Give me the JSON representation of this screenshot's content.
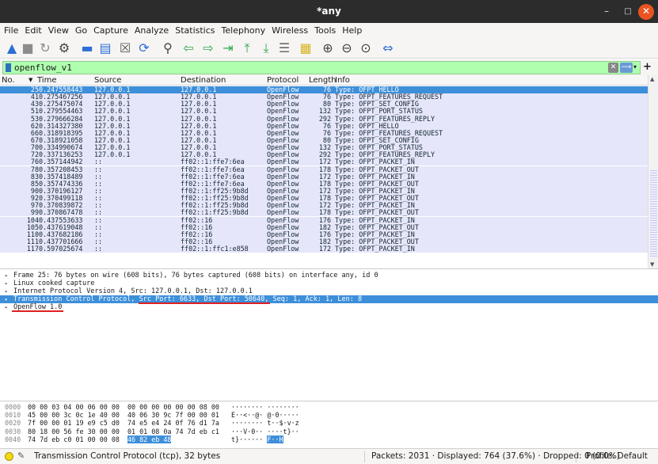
{
  "window": {
    "title": "*any"
  },
  "menu": [
    "File",
    "Edit",
    "View",
    "Go",
    "Capture",
    "Analyze",
    "Statistics",
    "Telephony",
    "Wireless",
    "Tools",
    "Help"
  ],
  "filter": {
    "value": "openflow_v1"
  },
  "columns": {
    "no": "No.",
    "time": "Time",
    "source": "Source",
    "destination": "Destination",
    "protocol": "Protocol",
    "length": "Length",
    "info": "Info"
  },
  "packets": [
    {
      "no": "25",
      "time": "0.247558443",
      "src": "127.0.0.1",
      "dst": "127.0.0.1",
      "proto": "OpenFlow",
      "len": "76",
      "info": "Type: OFPT_HELLO",
      "selected": true
    },
    {
      "no": "41",
      "time": "0.275467256",
      "src": "127.0.0.1",
      "dst": "127.0.0.1",
      "proto": "OpenFlow",
      "len": "76",
      "info": "Type: OFPT_FEATURES_REQUEST"
    },
    {
      "no": "43",
      "time": "0.275475074",
      "src": "127.0.0.1",
      "dst": "127.0.0.1",
      "proto": "OpenFlow",
      "len": "80",
      "info": "Type: OFPT_SET_CONFIG"
    },
    {
      "no": "51",
      "time": "0.279554463",
      "src": "127.0.0.1",
      "dst": "127.0.0.1",
      "proto": "OpenFlow",
      "len": "132",
      "info": "Type: OFPT_PORT_STATUS"
    },
    {
      "no": "53",
      "time": "0.279666284",
      "src": "127.0.0.1",
      "dst": "127.0.0.1",
      "proto": "OpenFlow",
      "len": "292",
      "info": "Type: OFPT_FEATURES_REPLY"
    },
    {
      "no": "62",
      "time": "0.314327380",
      "src": "127.0.0.1",
      "dst": "127.0.0.1",
      "proto": "OpenFlow",
      "len": "76",
      "info": "Type: OFPT_HELLO"
    },
    {
      "no": "66",
      "time": "0.318918395",
      "src": "127.0.0.1",
      "dst": "127.0.0.1",
      "proto": "OpenFlow",
      "len": "76",
      "info": "Type: OFPT_FEATURES_REQUEST"
    },
    {
      "no": "67",
      "time": "0.318921058",
      "src": "127.0.0.1",
      "dst": "127.0.0.1",
      "proto": "OpenFlow",
      "len": "80",
      "info": "Type: OFPT_SET_CONFIG"
    },
    {
      "no": "70",
      "time": "0.334990674",
      "src": "127.0.0.1",
      "dst": "127.0.0.1",
      "proto": "OpenFlow",
      "len": "132",
      "info": "Type: OFPT_PORT_STATUS"
    },
    {
      "no": "72",
      "time": "0.337136253",
      "src": "127.0.0.1",
      "dst": "127.0.0.1",
      "proto": "OpenFlow",
      "len": "292",
      "info": "Type: OFPT_FEATURES_REPLY"
    },
    {
      "no": "76",
      "time": "0.357144942",
      "src": "::",
      "dst": "ff02::1:ffe7:6ea",
      "proto": "OpenFlow",
      "len": "172",
      "info": "Type: OFPT_PACKET_IN"
    },
    {
      "no": "78",
      "time": "0.357208453",
      "src": "::",
      "dst": "ff02::1:ffe7:6ea",
      "proto": "OpenFlow",
      "len": "178",
      "info": "Type: OFPT_PACKET_OUT"
    },
    {
      "no": "83",
      "time": "0.357418489",
      "src": "::",
      "dst": "ff02::1:ffe7:6ea",
      "proto": "OpenFlow",
      "len": "172",
      "info": "Type: OFPT_PACKET_IN"
    },
    {
      "no": "85",
      "time": "0.357474336",
      "src": "::",
      "dst": "ff02::1:ffe7:6ea",
      "proto": "OpenFlow",
      "len": "178",
      "info": "Type: OFPT_PACKET_OUT"
    },
    {
      "no": "90",
      "time": "0.370196127",
      "src": "::",
      "dst": "ff02::1:ff25:9b8d",
      "proto": "OpenFlow",
      "len": "172",
      "info": "Type: OFPT_PACKET_IN"
    },
    {
      "no": "92",
      "time": "0.370499118",
      "src": "::",
      "dst": "ff02::1:ff25:9b8d",
      "proto": "OpenFlow",
      "len": "178",
      "info": "Type: OFPT_PACKET_OUT"
    },
    {
      "no": "97",
      "time": "0.370839872",
      "src": "::",
      "dst": "ff02::1:ff25:9b8d",
      "proto": "OpenFlow",
      "len": "172",
      "info": "Type: OFPT_PACKET_IN"
    },
    {
      "no": "99",
      "time": "0.370867478",
      "src": "::",
      "dst": "ff02::1:ff25:9b8d",
      "proto": "OpenFlow",
      "len": "178",
      "info": "Type: OFPT_PACKET_OUT"
    },
    {
      "no": "104",
      "time": "0.437553633",
      "src": "::",
      "dst": "ff02::16",
      "proto": "OpenFlow",
      "len": "176",
      "info": "Type: OFPT_PACKET_IN"
    },
    {
      "no": "105",
      "time": "0.437619048",
      "src": "::",
      "dst": "ff02::16",
      "proto": "OpenFlow",
      "len": "182",
      "info": "Type: OFPT_PACKET_OUT"
    },
    {
      "no": "110",
      "time": "0.437682186",
      "src": "::",
      "dst": "ff02::16",
      "proto": "OpenFlow",
      "len": "176",
      "info": "Type: OFPT_PACKET_IN"
    },
    {
      "no": "111",
      "time": "0.437701666",
      "src": "::",
      "dst": "ff02::16",
      "proto": "OpenFlow",
      "len": "182",
      "info": "Type: OFPT_PACKET_OUT"
    },
    {
      "no": "117",
      "time": "0.597025674",
      "src": "::",
      "dst": "ff02::1:ffc1:e858",
      "proto": "OpenFlow",
      "len": "172",
      "info": "Type: OFPT_PACKET_IN"
    }
  ],
  "details": [
    {
      "text": "Frame 25: 76 bytes on wire (608 bits), 76 bytes captured (608 bits) on interface any, id 0"
    },
    {
      "text": "Linux cooked capture"
    },
    {
      "text": "Internet Protocol Version 4, Src: 127.0.0.1, Dst: 127.0.0.1"
    },
    {
      "text": "Transmission Control Protocol, Src Port: 6633, Dst Port: 50640, Seq: 1, Ack: 1, Len: 8",
      "selected": true
    },
    {
      "text": "OpenFlow 1.0"
    }
  ],
  "hex": [
    {
      "off": "0000",
      "b1": "00 00 03 04 00 06 00 00",
      "b2": "00 00 00 00 00 00 08 00",
      "asc": "········ ········"
    },
    {
      "off": "0010",
      "b1": "45 00 00 3c 0c 1e 40 00",
      "b2": "40 06 30 9c 7f 00 00 01",
      "asc": "E··<··@· @·0·····"
    },
    {
      "off": "0020",
      "b1": "7f 00 00 01 19 e9 c5 d0",
      "b2": "74 e5 e4 24 0f 76 d1 7a",
      "asc": "········ t··$·v·z"
    },
    {
      "off": "0030",
      "b1": "80 18 00 56 fe 30 00 00",
      "b2": "01 01 08 0a 74 7d eb c1",
      "asc": "···V·0·· ····t}··"
    },
    {
      "off": "0040",
      "b1": "74 7d eb c0 01 00 00 08",
      "b2": "46 82 eb 48",
      "asc": "t}······ F··H"
    }
  ],
  "status": {
    "left": "Transmission Control Protocol (tcp), 32 bytes",
    "packets": "Packets: 2031 · Displayed: 764 (37.6%) · Dropped: 0 (0.0%)",
    "profile": "Profile: Default"
  },
  "colors": {
    "selection": "#3d8fd9",
    "row_bg": "#e6e6fa",
    "filter_ok": "#afffaf",
    "close_button": "#e95420",
    "annotation": "#e02020"
  },
  "toolbar_icons": [
    "shark-fin-start-icon",
    "stop-icon",
    "restart-icon",
    "options-gear-icon",
    "open-folder-icon",
    "file-icon",
    "close-file-icon",
    "reload-icon",
    "search-icon",
    "back-arrow-icon",
    "forward-arrow-icon",
    "go-to-packet-icon",
    "first-packet-icon",
    "last-packet-icon",
    "autoscroll-icon",
    "colorize-icon",
    "zoom-in-icon",
    "zoom-out-icon",
    "zoom-reset-icon",
    "resize-columns-icon"
  ]
}
